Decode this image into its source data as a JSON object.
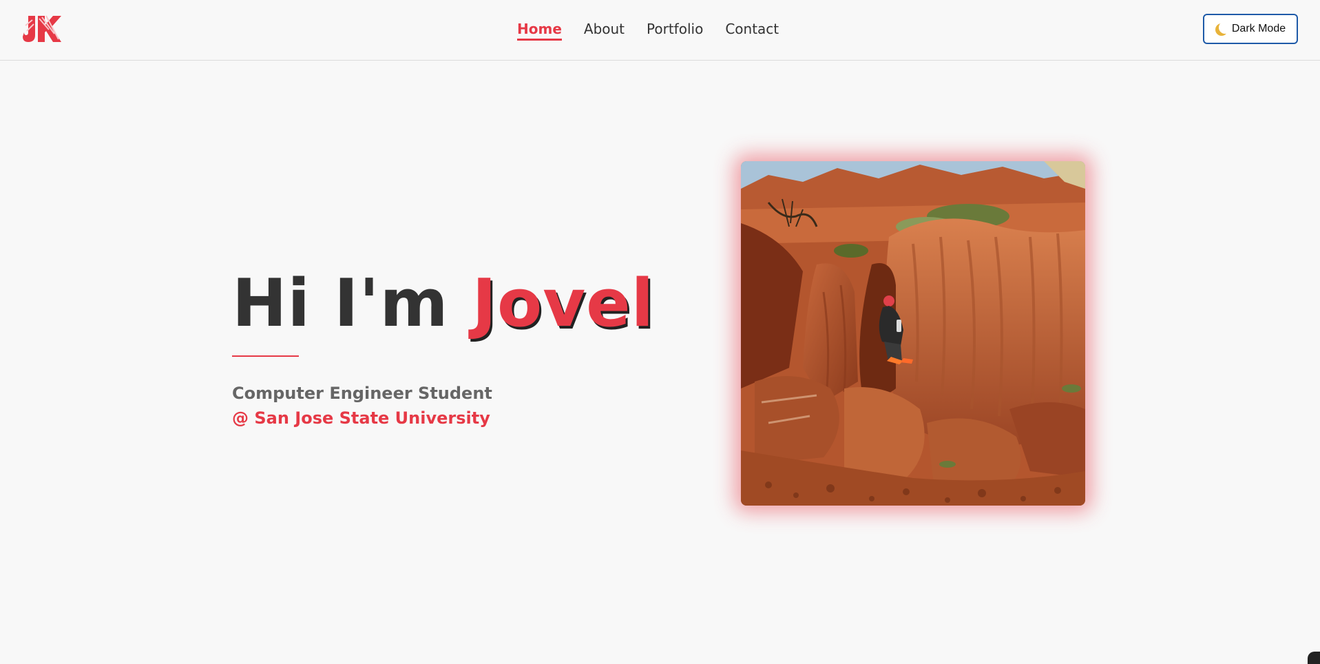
{
  "header": {
    "logo_alt": "JK logo",
    "nav": [
      {
        "label": "Home",
        "active": true
      },
      {
        "label": "About",
        "active": false
      },
      {
        "label": "Portfolio",
        "active": false
      },
      {
        "label": "Contact",
        "active": false
      }
    ],
    "dark_mode_label": "Dark Mode",
    "dark_mode_icon": "moon-icon"
  },
  "hero": {
    "greeting": "Hi I'm ",
    "name": "Jovel",
    "subtitle": "Computer Engineer Student",
    "school": "@ San Jose State University",
    "photo_description_icon": "profile-photo"
  },
  "colors": {
    "accent": "#e63946",
    "text": "#333333",
    "subtext": "#666666",
    "background": "#f8f8f8",
    "button_border": "#1e5aa8"
  }
}
